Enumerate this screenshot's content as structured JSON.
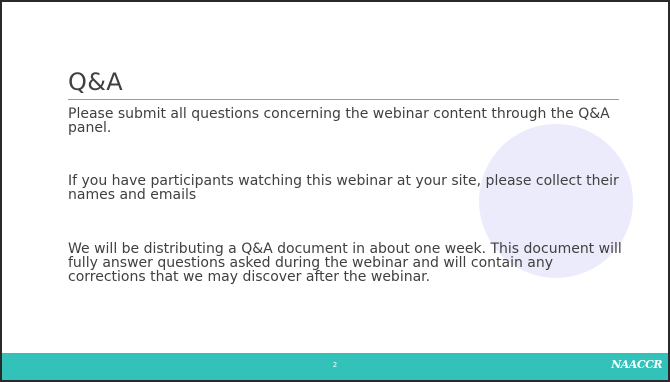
{
  "slide": {
    "title": "Q&A",
    "paragraphs": [
      "Please submit all questions concerning the webinar content through the Q&A panel.",
      "If you have participants watching this webinar at your site, please collect their names and emails",
      "We will be distributing a Q&A document in about one week.  This document will fully answer questions asked during the webinar and will contain any corrections that we may discover after the webinar."
    ],
    "page_number": "2",
    "logo_text": "NAACCR"
  },
  "colors": {
    "footer_bar": "#33c2ba",
    "decorative_circle": "#ecebfb",
    "text": "#404040"
  }
}
